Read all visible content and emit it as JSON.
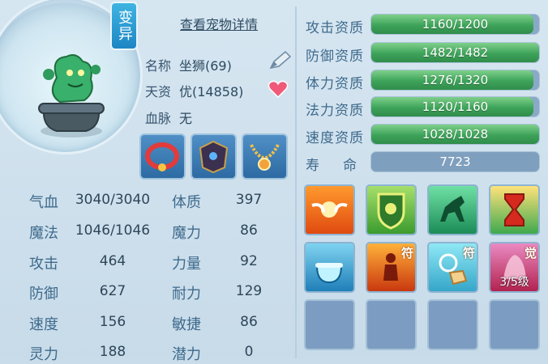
{
  "badge": "变异",
  "detail_link": "查看宠物详情",
  "info": {
    "name_label": "名称",
    "name_value": "坐狮(69)",
    "talent_label": "天资",
    "talent_value": "优(14858)",
    "bloodline_label": "血脉",
    "bloodline_value": "无"
  },
  "equipment": [
    {
      "name": "red-necklace"
    },
    {
      "name": "dark-armor"
    },
    {
      "name": "gold-necklace"
    }
  ],
  "stats": [
    {
      "label": "气血",
      "value": "3040/3040",
      "label2": "体质",
      "value2": "397"
    },
    {
      "label": "魔法",
      "value": "1046/1046",
      "label2": "魔力",
      "value2": "86"
    },
    {
      "label": "攻击",
      "value": "464",
      "label2": "力量",
      "value2": "92"
    },
    {
      "label": "防御",
      "value": "627",
      "label2": "耐力",
      "value2": "129"
    },
    {
      "label": "速度",
      "value": "156",
      "label2": "敏捷",
      "value2": "86"
    },
    {
      "label": "灵力",
      "value": "188",
      "label2": "潜力",
      "value2": "0"
    }
  ],
  "aptitudes": [
    {
      "label": "攻击资质",
      "text": "1160/1200",
      "fraction": 0.9667
    },
    {
      "label": "防御资质",
      "text": "1482/1482",
      "fraction": 1.0
    },
    {
      "label": "体力资质",
      "text": "1276/1320",
      "fraction": 0.9667
    },
    {
      "label": "法力资质",
      "text": "1120/1160",
      "fraction": 0.9655
    },
    {
      "label": "速度资质",
      "text": "1028/1028",
      "fraction": 1.0
    }
  ],
  "life": {
    "label": "寿　命",
    "value": "7723"
  },
  "skills": [
    {
      "name": "winged-emblem-skill",
      "fu": ""
    },
    {
      "name": "shield-skill",
      "fu": ""
    },
    {
      "name": "green-horse-skill",
      "fu": ""
    },
    {
      "name": "hourglass-skill",
      "fu": ""
    },
    {
      "name": "cauldron-skill",
      "fu": ""
    },
    {
      "name": "figure-talisman-skill",
      "fu": "符"
    },
    {
      "name": "hand-talisman-skill",
      "fu": "符"
    },
    {
      "name": "awakening-skill",
      "fu": "觉",
      "level": "3/5级"
    }
  ],
  "colors": {
    "bar_fill": "#3ea35a",
    "bar_bg": "#8aa9c6",
    "badge": "#1d86c4"
  }
}
